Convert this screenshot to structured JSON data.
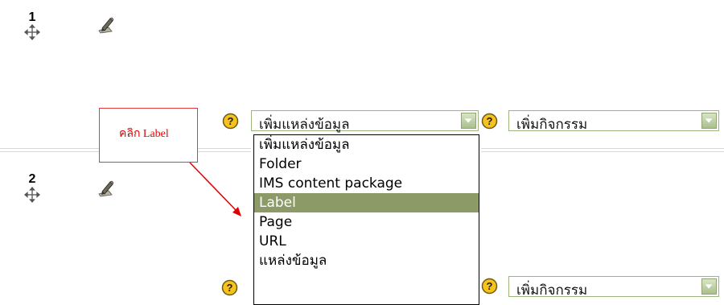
{
  "sections": [
    {
      "number": "1"
    },
    {
      "number": "2"
    }
  ],
  "resource_select": {
    "value": "เพิ่มแหล่งข้อมูล",
    "options": [
      "เพิ่มแหล่งข้อมูล",
      "Folder",
      "IMS content package",
      "Label",
      "Page",
      "URL",
      "แหล่งข้อมูล"
    ],
    "highlighted": "Label"
  },
  "activity_select": {
    "value": "เพิ่มกิจกรรม"
  },
  "annotation": {
    "text": "คลิก Label",
    "color": "#e10000"
  },
  "icons": {
    "move": "move-arrows-icon",
    "edit": "edit-pencil-icon",
    "help": "help-question-icon",
    "dropdown": "chevron-down-icon"
  }
}
